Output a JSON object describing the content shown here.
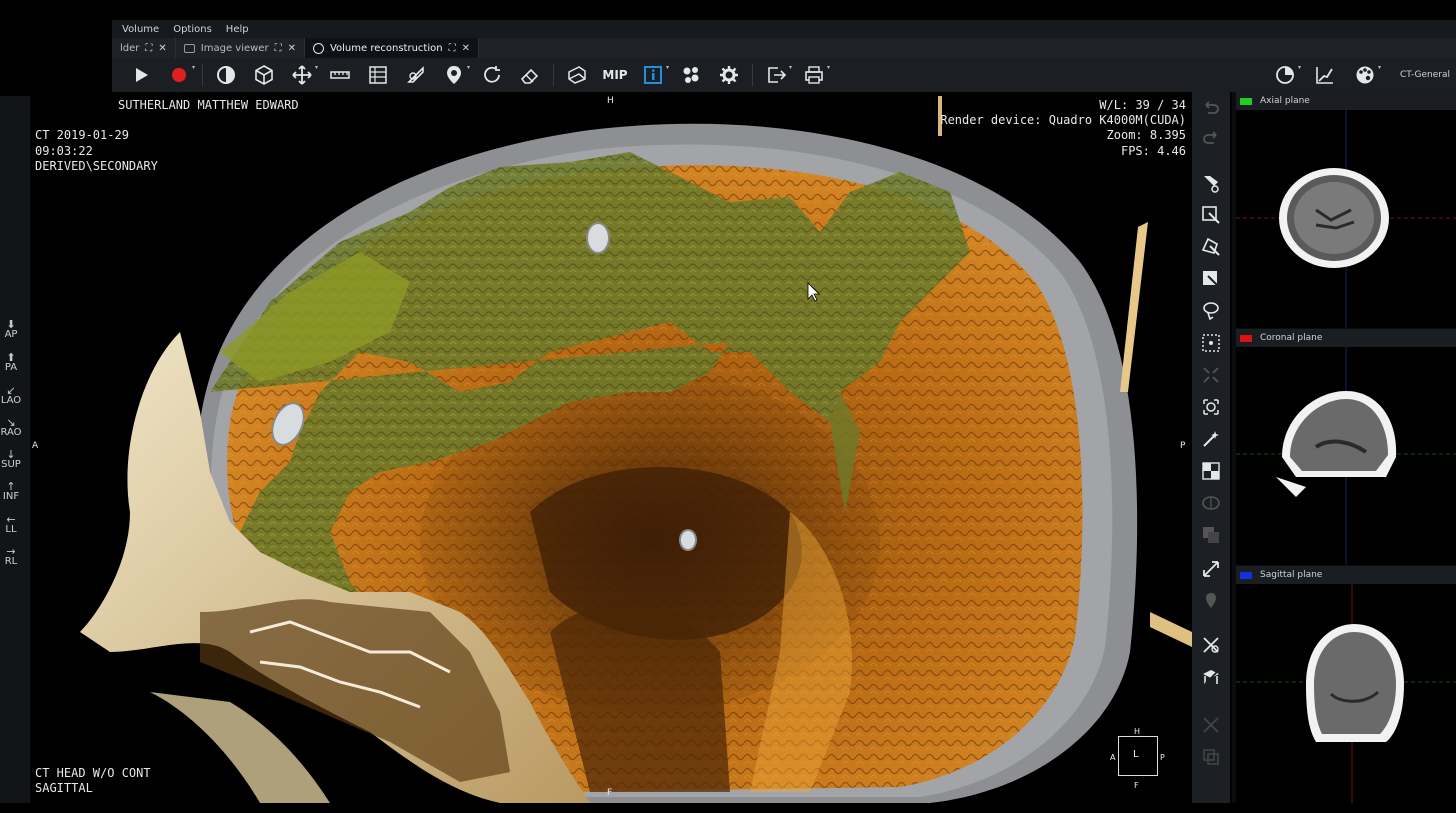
{
  "menu": {
    "items": [
      "Volume",
      "Options",
      "Help"
    ]
  },
  "tabs": [
    {
      "label": "lder",
      "active": false
    },
    {
      "label": "Image viewer",
      "active": false
    },
    {
      "label": "Volume reconstruction",
      "active": true
    }
  ],
  "toolbar": {
    "mip_label": "MIP",
    "preset": "CT-General"
  },
  "patient": {
    "name": "SUTHERLAND MATTHEW EDWARD",
    "study_line1": "CT 2019-01-29",
    "study_line2": "09:03:22",
    "study_line3": "DERIVED\\SECONDARY",
    "series_line1": "CT HEAD W/O CONT",
    "series_line2": "SAGITTAL"
  },
  "render_info": {
    "wl": "W/L: 39 / 34",
    "device": "Render device: Quadro K4000M(CUDA)",
    "zoom": "Zoom: 8.395",
    "fps": "FPS: 4.46"
  },
  "edge_markers": {
    "top": "H",
    "bottom": "F",
    "left": "A",
    "right": "P"
  },
  "orientation_cube": {
    "top": "H",
    "bottom": "F",
    "left": "A",
    "right": "P",
    "center": "L"
  },
  "orientation_buttons": [
    "AP",
    "PA",
    "LAO",
    "RAO",
    "SUP",
    "INF",
    "LL",
    "RL"
  ],
  "planes": [
    {
      "label": "Axial plane",
      "color": "#22cc22"
    },
    {
      "label": "Coronal plane",
      "color": "#dd1111"
    },
    {
      "label": "Sagittal plane",
      "color": "#1133dd"
    }
  ],
  "colors": {
    "accent": "#1f8fe0",
    "record": "#e02020"
  }
}
